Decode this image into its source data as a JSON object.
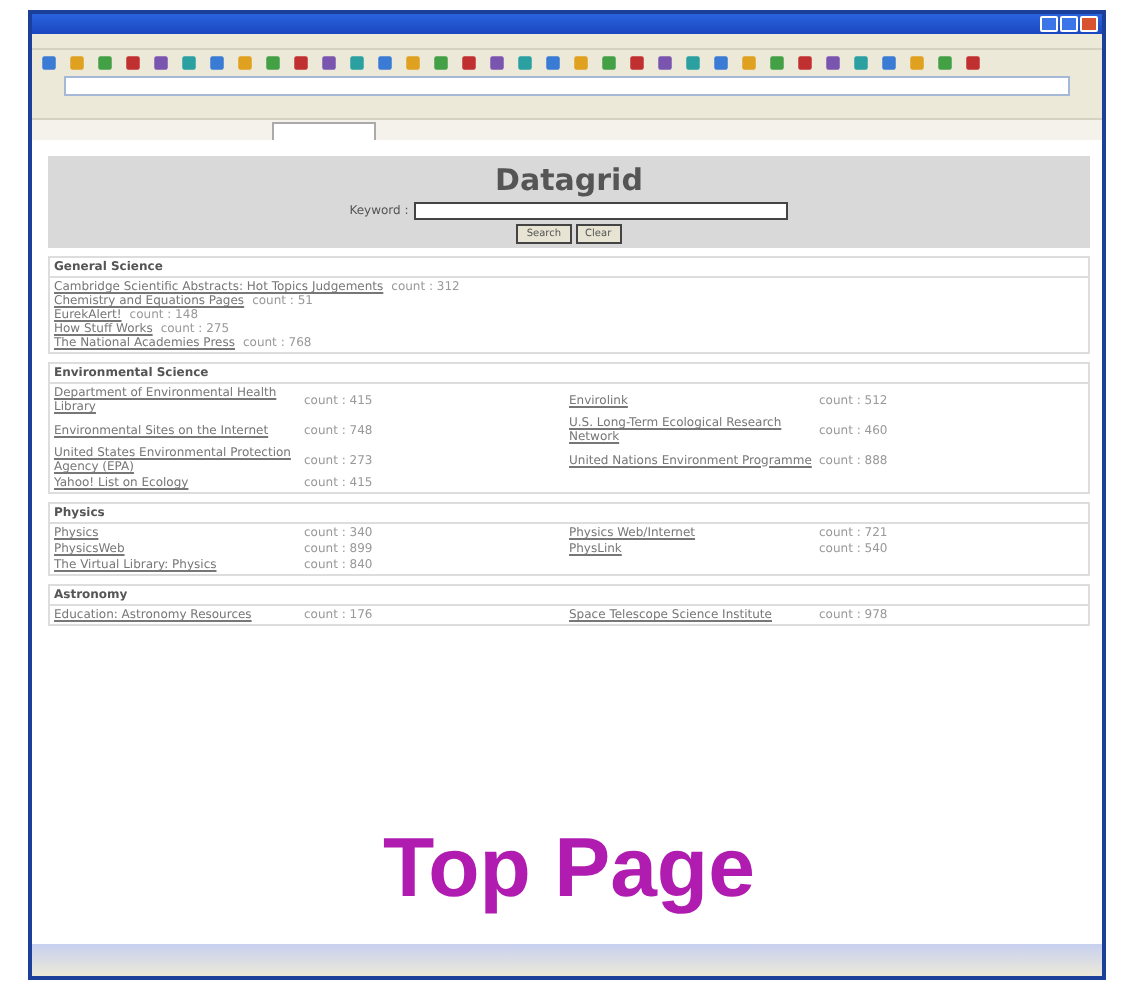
{
  "page": {
    "heading": "Datagrid",
    "keyword_label": "Keyword :",
    "buttons": [
      "Search",
      "Clear"
    ]
  },
  "sections": [
    {
      "title": "General Science",
      "kind": "list",
      "items": [
        {
          "title": "Cambridge Scientific Abstracts: Hot Topics Judgements",
          "count": "count : 312"
        },
        {
          "title": "Chemistry and Equations Pages",
          "count": "count : 51"
        },
        {
          "title": "EurekAlert!",
          "count": "count : 148"
        },
        {
          "title": "How Stuff Works",
          "count": "count : 275"
        },
        {
          "title": "The National Academies Press",
          "count": "count : 768"
        }
      ]
    },
    {
      "title": "Environmental Science",
      "kind": "grid",
      "items": [
        {
          "title": "Department of Environmental Health Library",
          "count": "count : 415"
        },
        {
          "title": "Envirolink",
          "count": "count : 512"
        },
        {
          "title": "Environmental Sites on the Internet",
          "count": "count : 748"
        },
        {
          "title": "U.S. Long-Term Ecological Research Network",
          "count": "count : 460"
        },
        {
          "title": "United States Environmental Protection Agency (EPA)",
          "count": "count : 273"
        },
        {
          "title": "United Nations Environment Programme",
          "count": "count : 888"
        },
        {
          "title": "Yahoo! List on Ecology",
          "count": "count : 415"
        }
      ]
    },
    {
      "title": "Physics",
      "kind": "grid",
      "items": [
        {
          "title": "Physics",
          "count": "count : 340"
        },
        {
          "title": "Physics Web/Internet",
          "count": "count : 721"
        },
        {
          "title": "PhysicsWeb",
          "count": "count : 899"
        },
        {
          "title": "PhysLink",
          "count": "count : 540"
        },
        {
          "title": "The Virtual Library: Physics",
          "count": "count : 840"
        }
      ]
    },
    {
      "title": "Astronomy",
      "kind": "grid",
      "items": [
        {
          "title": "Education: Astronomy Resources",
          "count": "count : 176"
        },
        {
          "title": "Space Telescope Science Institute",
          "count": "count : 978"
        }
      ]
    }
  ],
  "caption": "Top Page"
}
